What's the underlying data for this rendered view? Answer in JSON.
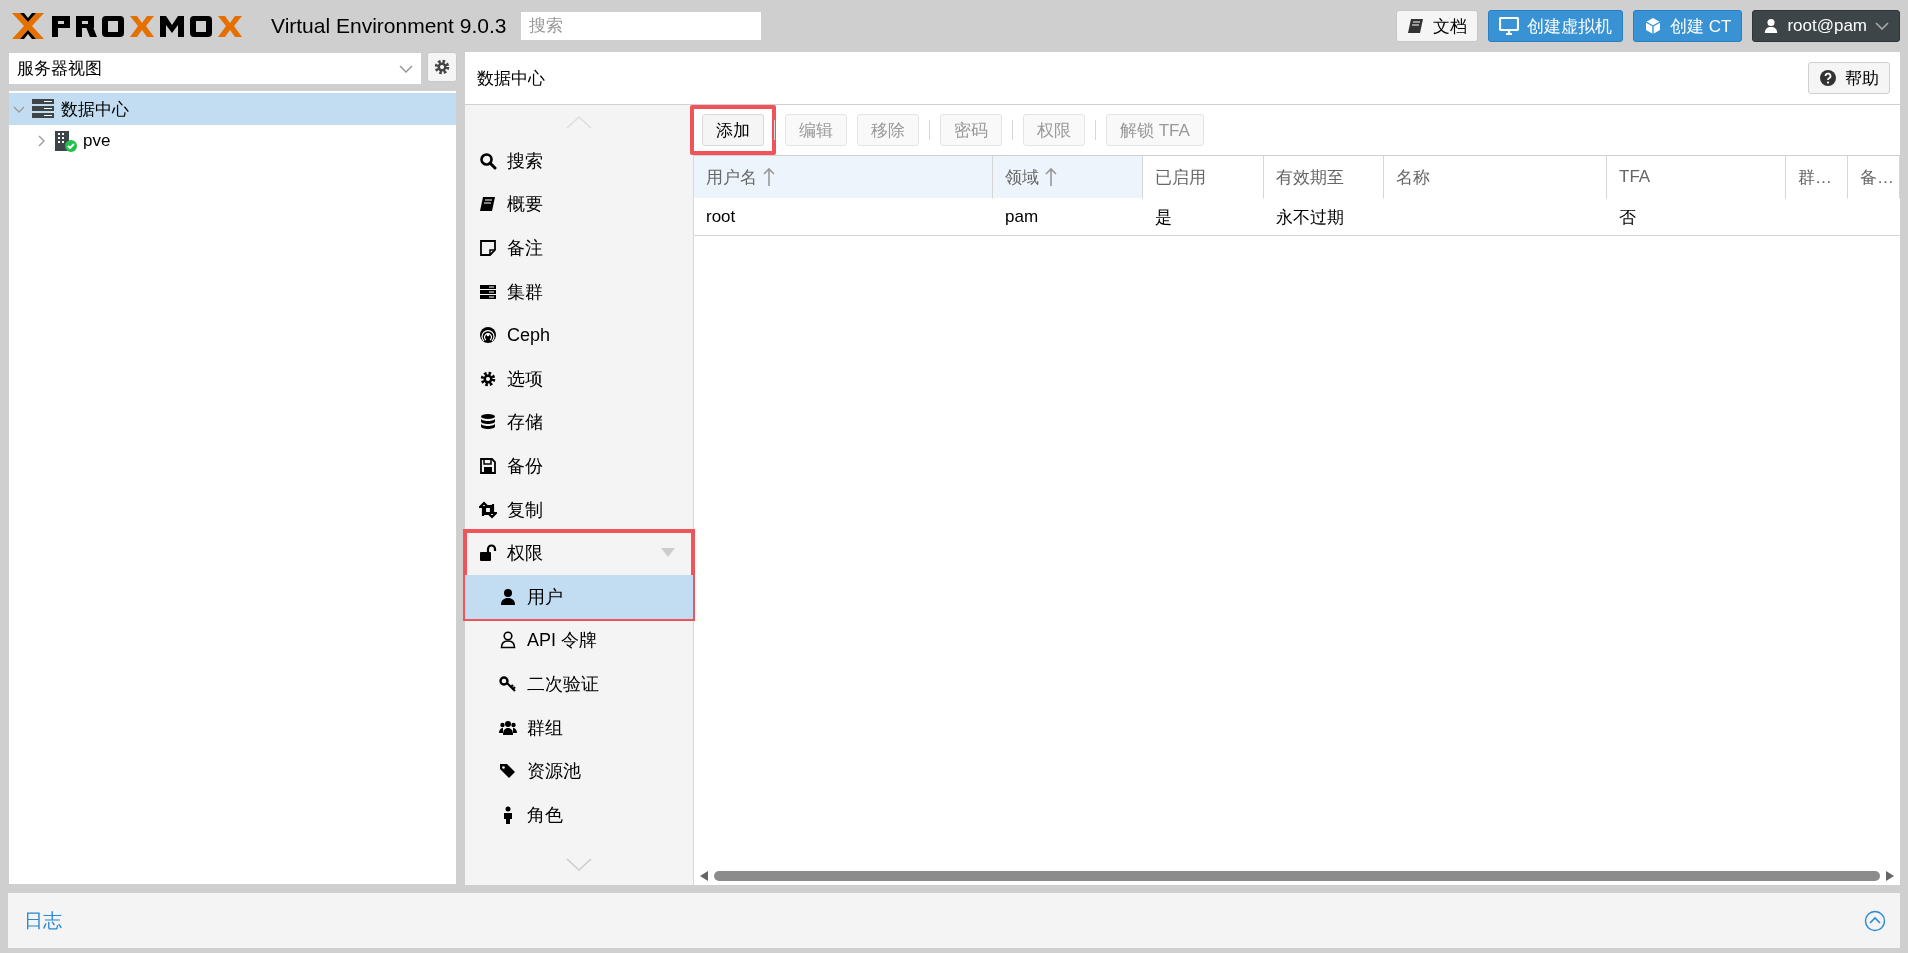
{
  "header": {
    "product": "Virtual Environment 9.0.3",
    "search": {
      "placeholder": "搜索"
    },
    "buttons": [
      {
        "label": "文档",
        "kind": "docs"
      },
      {
        "label": "创建虚拟机",
        "kind": "vm"
      },
      {
        "label": "创建 CT",
        "kind": "ct"
      }
    ],
    "user": {
      "label": "root@pam"
    }
  },
  "sidebar": {
    "view": {
      "value": "服务器视图"
    },
    "tree": [
      {
        "label": "数据中心",
        "kind": "datacenter",
        "selected": true,
        "expanded": true,
        "children": [
          {
            "label": "pve",
            "kind": "node",
            "selected": false,
            "expanded": false
          }
        ]
      }
    ]
  },
  "panel": {
    "title": "数据中心",
    "help": "帮助"
  },
  "nav": [
    {
      "label": "搜索",
      "kind": "search",
      "selected": false
    },
    {
      "label": "概要",
      "kind": "book",
      "selected": false
    },
    {
      "label": "备注",
      "kind": "note",
      "selected": false
    },
    {
      "label": "集群",
      "kind": "cluster",
      "selected": false
    },
    {
      "label": "Ceph",
      "kind": "ceph",
      "selected": false
    },
    {
      "label": "选项",
      "kind": "gear",
      "selected": false
    },
    {
      "label": "存储",
      "kind": "database",
      "selected": false
    },
    {
      "label": "备份",
      "kind": "floppy",
      "selected": false
    },
    {
      "label": "复制",
      "kind": "retweet",
      "selected": false
    },
    {
      "label": "权限",
      "kind": "unlock",
      "selected": false,
      "expanded": true,
      "highlighted": true,
      "children": [
        {
          "label": "用户",
          "kind": "user",
          "selected": true
        },
        {
          "label": "API 令牌",
          "kind": "token",
          "selected": false
        },
        {
          "label": "二次验证",
          "kind": "key",
          "selected": false
        },
        {
          "label": "群组",
          "kind": "users",
          "selected": false
        },
        {
          "label": "资源池",
          "kind": "tags",
          "selected": false
        },
        {
          "label": "角色",
          "kind": "male",
          "selected": false
        }
      ]
    }
  ],
  "toolbar": [
    {
      "kind": "button",
      "label": "添加",
      "disabled": false,
      "highlighted": true
    },
    {
      "kind": "separator"
    },
    {
      "kind": "button",
      "label": "编辑",
      "disabled": true,
      "highlighted": false
    },
    {
      "kind": "button",
      "label": "移除",
      "disabled": true,
      "highlighted": false
    },
    {
      "kind": "separator"
    },
    {
      "kind": "button",
      "label": "密码",
      "disabled": true,
      "highlighted": false
    },
    {
      "kind": "separator"
    },
    {
      "kind": "button",
      "label": "权限",
      "disabled": true,
      "highlighted": false
    },
    {
      "kind": "separator"
    },
    {
      "kind": "button",
      "label": "解锁 TFA",
      "disabled": true,
      "highlighted": false
    }
  ],
  "table": {
    "columns": [
      {
        "label": "用户名",
        "sorted": true
      },
      {
        "label": "领域",
        "sorted": true
      },
      {
        "label": "已启用",
        "sorted": false
      },
      {
        "label": "有效期至",
        "sorted": false
      },
      {
        "label": "名称",
        "sorted": false
      },
      {
        "label": "TFA",
        "sorted": false
      },
      {
        "label": "群…",
        "sorted": false
      },
      {
        "label": "备…",
        "sorted": false
      }
    ],
    "rows": [
      {
        "cells": [
          "root",
          "pam",
          "是",
          "永不过期",
          null,
          "否",
          null,
          null
        ]
      }
    ]
  },
  "log": {
    "title": "日志"
  }
}
